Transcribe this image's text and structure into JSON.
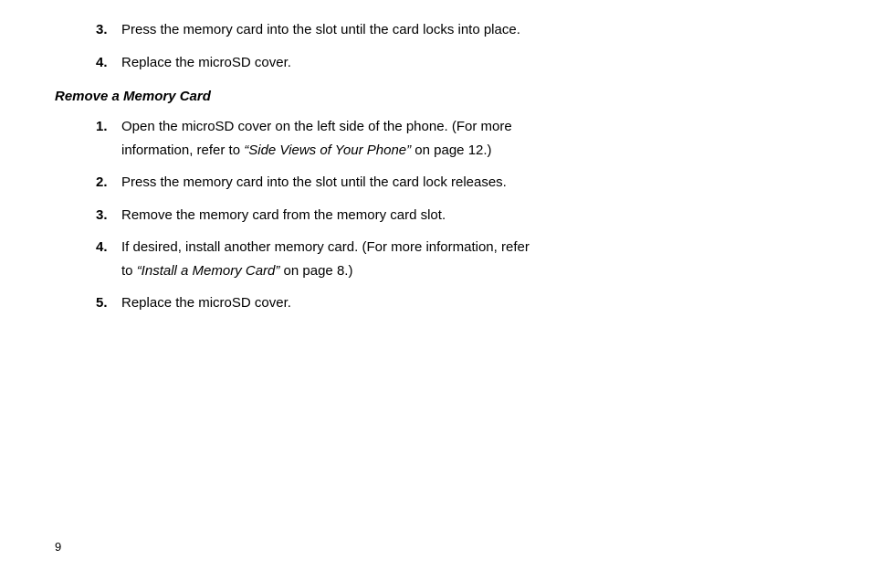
{
  "first_list": [
    {
      "num": "3.",
      "text_before": "Press the memory card into the slot until the card locks into place.",
      "ref": "",
      "text_after": ""
    },
    {
      "num": "4.",
      "text_before": "Replace the microSD cover.",
      "ref": "",
      "text_after": ""
    }
  ],
  "section_heading": "Remove a Memory Card",
  "second_list": [
    {
      "num": "1.",
      "text_before": "Open the microSD cover on the left side of the phone. (For more information, refer to ",
      "ref": "“Side Views of Your Phone”",
      "text_after": "  on page 12.)"
    },
    {
      "num": "2.",
      "text_before": "Press the memory card into the slot until the card lock releases.",
      "ref": "",
      "text_after": ""
    },
    {
      "num": "3.",
      "text_before": "Remove the memory card from the memory card slot.",
      "ref": "",
      "text_after": ""
    },
    {
      "num": "4.",
      "text_before": "If desired, install another memory card. (For more information, refer to ",
      "ref": "“Install a Memory Card”",
      "text_after": "  on page 8.)"
    },
    {
      "num": "5.",
      "text_before": "Replace the microSD cover.",
      "ref": "",
      "text_after": ""
    }
  ],
  "page_number": "9"
}
